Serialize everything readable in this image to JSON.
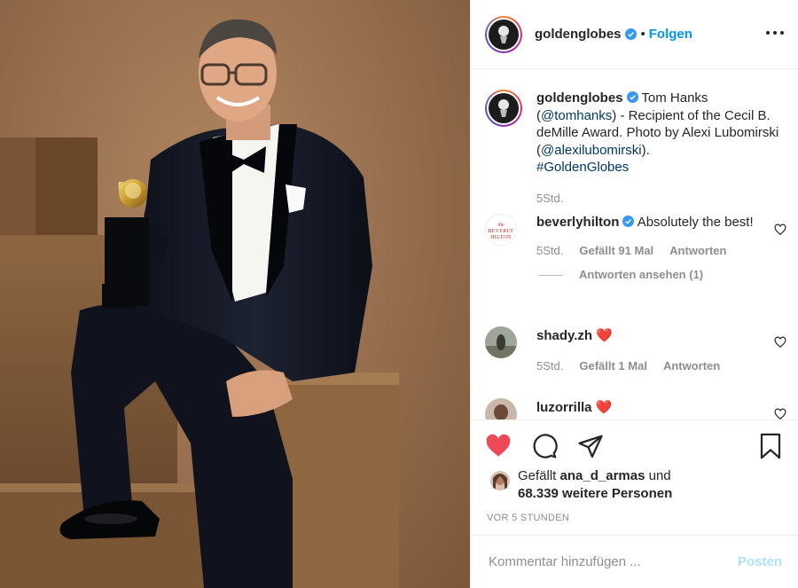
{
  "post": {
    "photo_alt": "Tom Hanks holding a Golden Globe award, seated on a wooden block",
    "author": {
      "username": "goldenglobes",
      "verified": true
    },
    "header": {
      "separator": "•",
      "follow_label": "Folgen",
      "more_icon": "more-horizontal-icon"
    },
    "caption": {
      "username": "goldenglobes",
      "text_1": "Tom Hanks (",
      "mention_1": "@tomhanks",
      "text_2": ") - Recipient of the Cecil B. deMille Award. Photo by Alexi Lubomirski (",
      "mention_2": "@alexilubomirski",
      "text_3": ").",
      "hashtag": "#GoldenGlobes",
      "time": "5Std."
    },
    "comments": [
      {
        "username": "beverlyhilton",
        "verified": true,
        "text": "Absolutely the best!",
        "time": "5Std.",
        "likes": "Gefällt 91 Mal",
        "reply": "Antworten",
        "view_replies": "Antworten ansehen (1)",
        "avatar_text_1": "the",
        "avatar_text_2": "BEVERLY",
        "avatar_text_3": "HILTON"
      },
      {
        "username": "shady.zh",
        "text": "❤️",
        "time": "5Std.",
        "likes": "Gefällt 1 Mal",
        "reply": "Antworten"
      },
      {
        "username": "luzorrilla",
        "text": "❤️"
      }
    ],
    "likes": {
      "prefix": "Gefällt",
      "liked_by": "ana_d_armas",
      "conjunction": "und",
      "others": "68.339 weitere Personen"
    },
    "timestamp": "VOR 5 STUNDEN",
    "comment_input": {
      "placeholder": "Kommentar hinzufügen ...",
      "post_label": "Posten"
    },
    "colors": {
      "accent": "#0095f6",
      "like_red": "#ed4956",
      "post_disabled": "#b2dffc",
      "link": "#00376b"
    }
  }
}
